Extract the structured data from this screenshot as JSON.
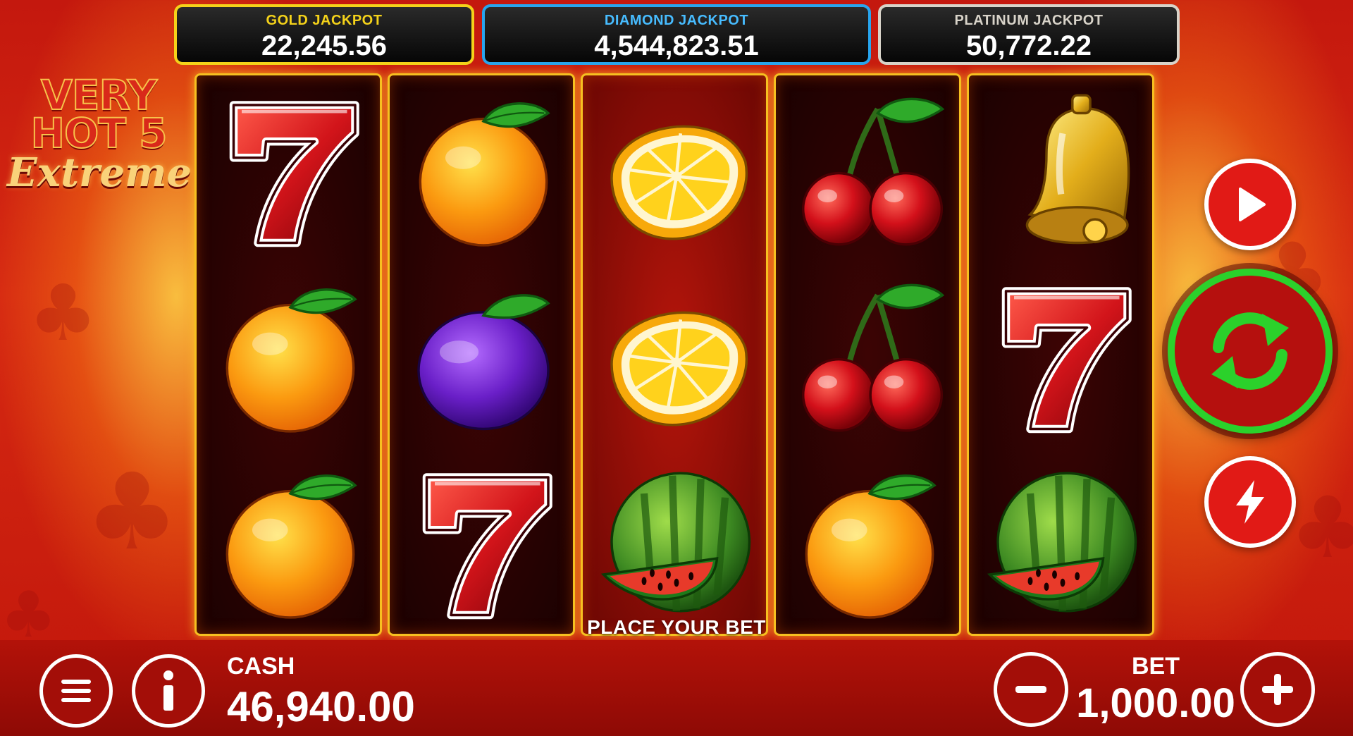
{
  "jackpots": {
    "gold": {
      "title": "GOLD JACKPOT",
      "value": "22,245.56"
    },
    "diamond": {
      "title": "DIAMOND JACKPOT",
      "value": "4,544,823.51"
    },
    "platinum": {
      "title": "PLATINUM JACKPOT",
      "value": "50,772.22"
    }
  },
  "logo": {
    "line1": "VERY",
    "line2": "HOT 5",
    "line3": "Extreme"
  },
  "reels": [
    [
      "seven",
      "orange",
      "orange"
    ],
    [
      "orange",
      "plum",
      "seven"
    ],
    [
      "lemon",
      "lemon",
      "watermelon"
    ],
    [
      "cherry",
      "cherry",
      "orange"
    ],
    [
      "bell",
      "seven",
      "watermelon"
    ]
  ],
  "status": {
    "message": "PLACE YOUR BET"
  },
  "controls": {
    "play_icon": "play-icon",
    "spin_icon": "refresh-icon",
    "turbo_icon": "lightning-icon",
    "spin_color": "#2bd12b"
  },
  "footer": {
    "menu_icon": "menu-icon",
    "info_icon": "info-icon",
    "cash_label": "CASH",
    "cash_value": "46,940.00",
    "bet_label": "BET",
    "bet_value": "1,000.00",
    "minus_icon": "minus-icon",
    "plus_icon": "plus-icon"
  },
  "colors": {
    "background": "#d62912",
    "reel_border": "#f6c020",
    "gold": "#f4d21a",
    "diamond": "#27a5ee",
    "platinum": "#d8d3c9"
  }
}
